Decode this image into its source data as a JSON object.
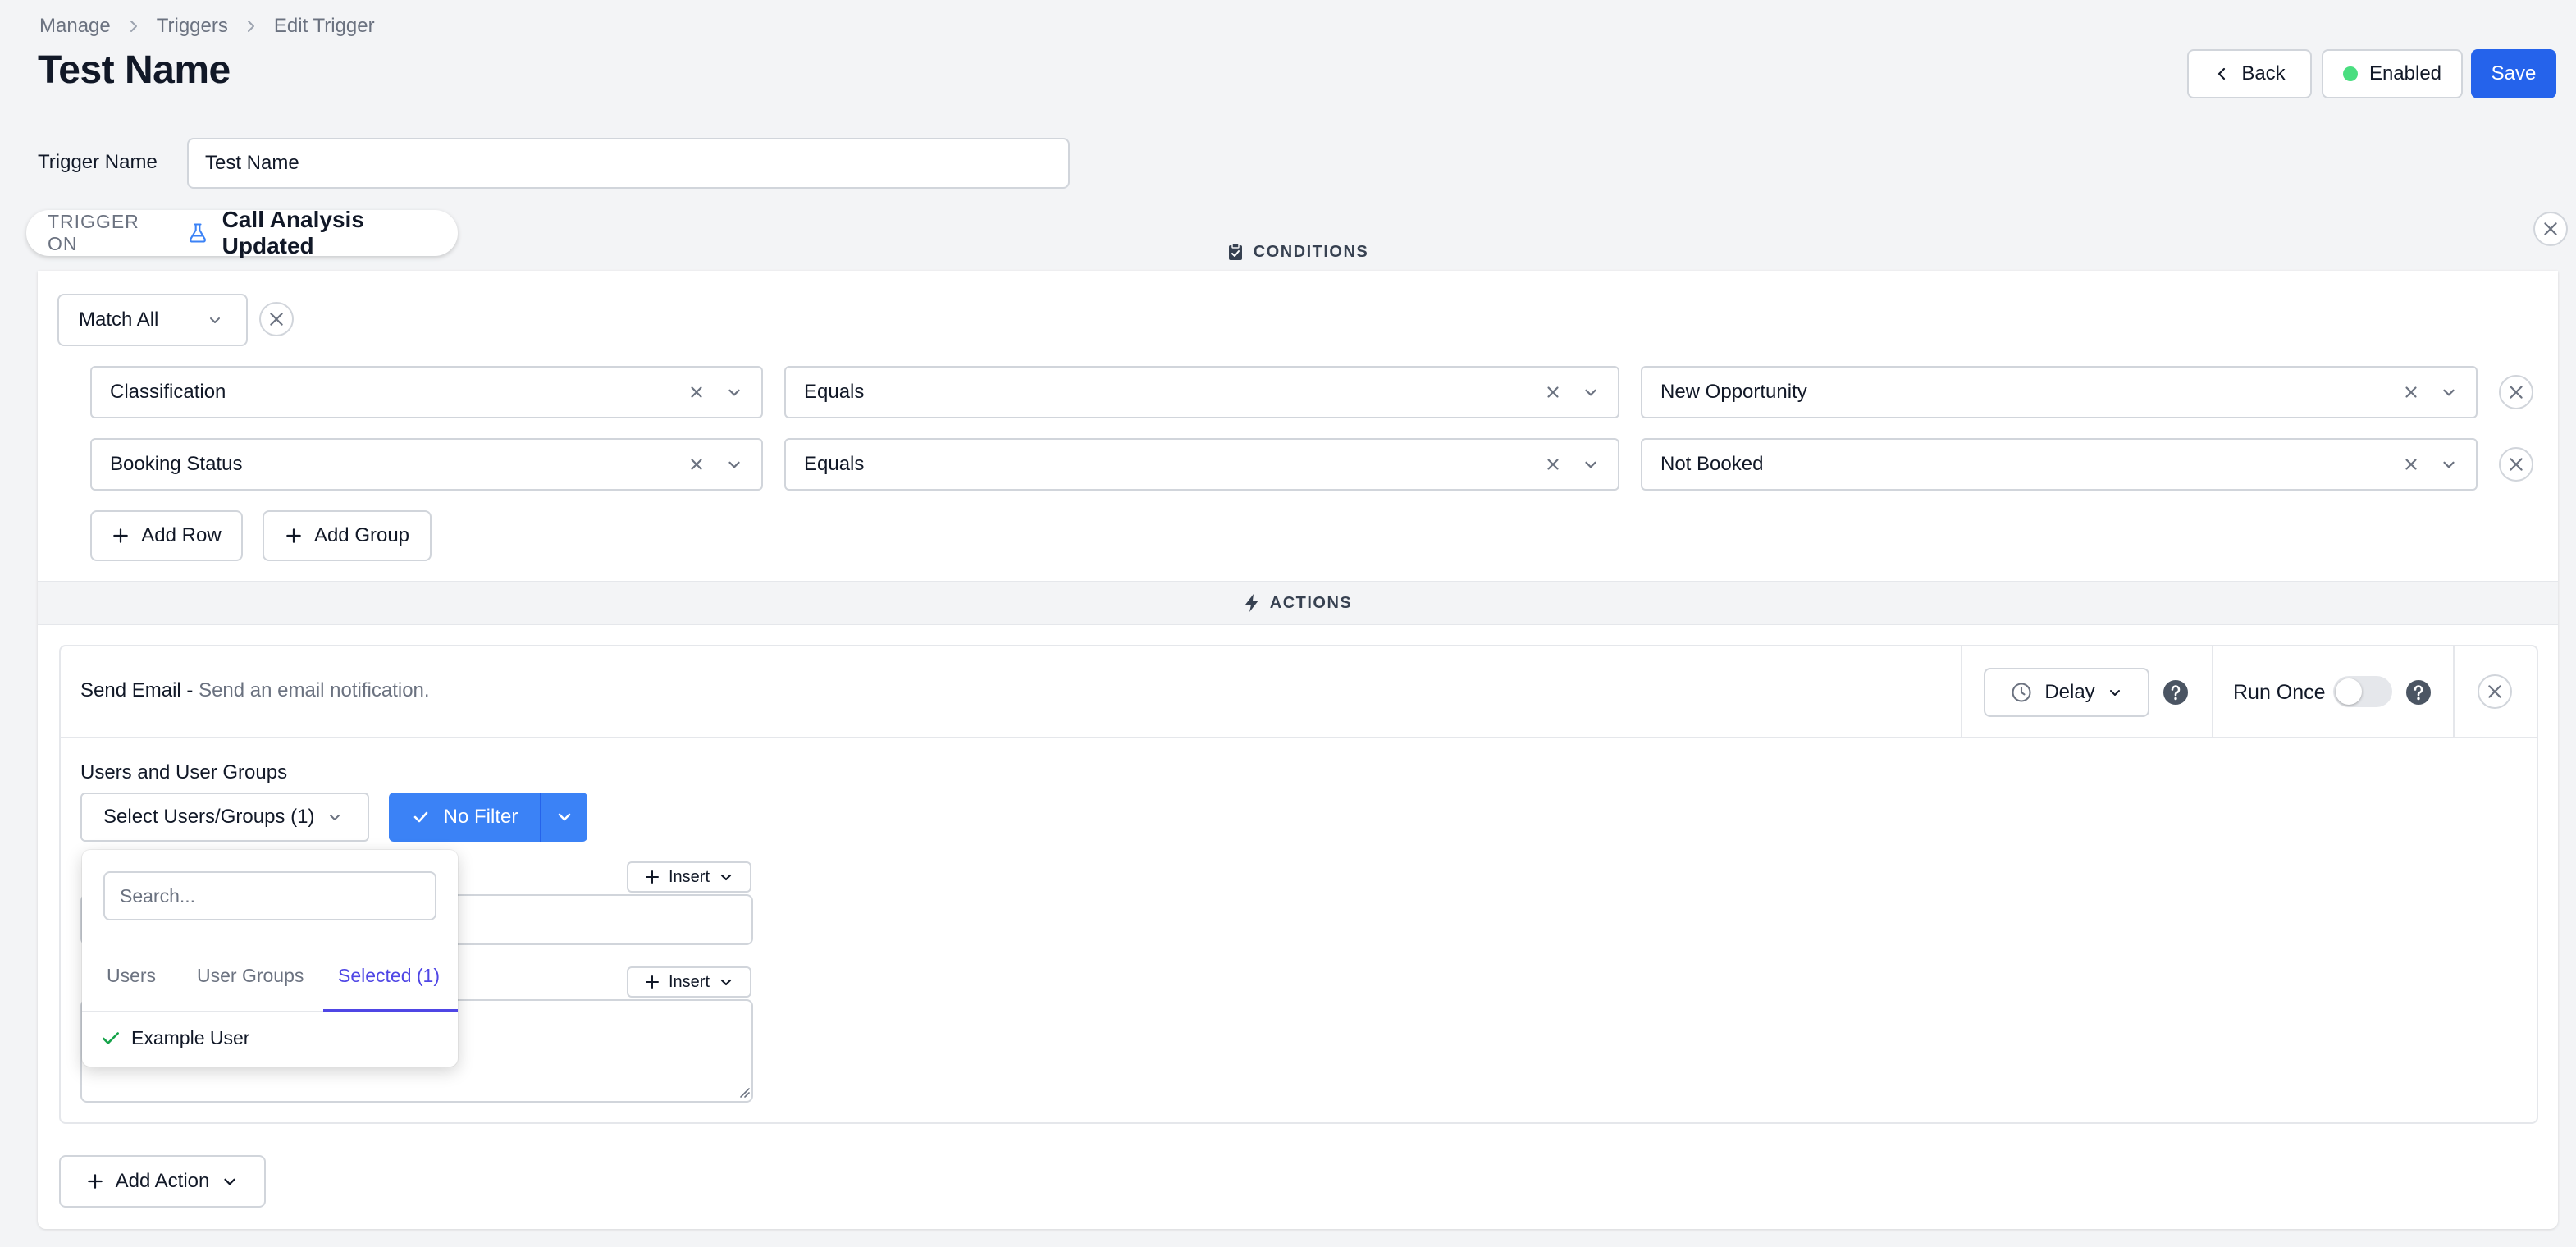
{
  "breadcrumb": {
    "items": [
      "Manage",
      "Triggers",
      "Edit Trigger"
    ]
  },
  "page": {
    "title": "Test Name"
  },
  "header": {
    "back_label": "Back",
    "enabled_label": "Enabled",
    "save_label": "Save",
    "status_color": "#4ade80",
    "accent": "#2563eb"
  },
  "trigger": {
    "name_label": "Trigger Name",
    "name_value": "Test Name",
    "on_label": "TRIGGER ON",
    "on_event": "Call Analysis Updated",
    "event_icon": "flask-icon"
  },
  "conditions": {
    "header": "CONDITIONS",
    "header_icon": "clipboard-check-icon",
    "match": "Match All",
    "rows": [
      {
        "field": "Classification",
        "operator": "Equals",
        "value": "New Opportunity"
      },
      {
        "field": "Booking Status",
        "operator": "Equals",
        "value": "Not Booked"
      }
    ],
    "add_row_label": "Add Row",
    "add_group_label": "Add Group"
  },
  "actions": {
    "header": "ACTIONS",
    "header_icon": "bolt-icon",
    "items": [
      {
        "title": "Send Email",
        "separator": " - ",
        "description": "Send an email notification.",
        "delay_label": "Delay",
        "run_once_label": "Run Once",
        "run_once": false,
        "users_label": "Users and User Groups",
        "select_label": "Select Users/Groups (1)",
        "filter_label": "No Filter",
        "insert_label": "Insert"
      }
    ],
    "add_action_label": "Add Action"
  },
  "dropdown": {
    "search_placeholder": "Search...",
    "tabs": [
      "Users",
      "User Groups",
      "Selected (1)"
    ],
    "active_tab": "Selected (1)",
    "items": [
      "Example User"
    ]
  }
}
